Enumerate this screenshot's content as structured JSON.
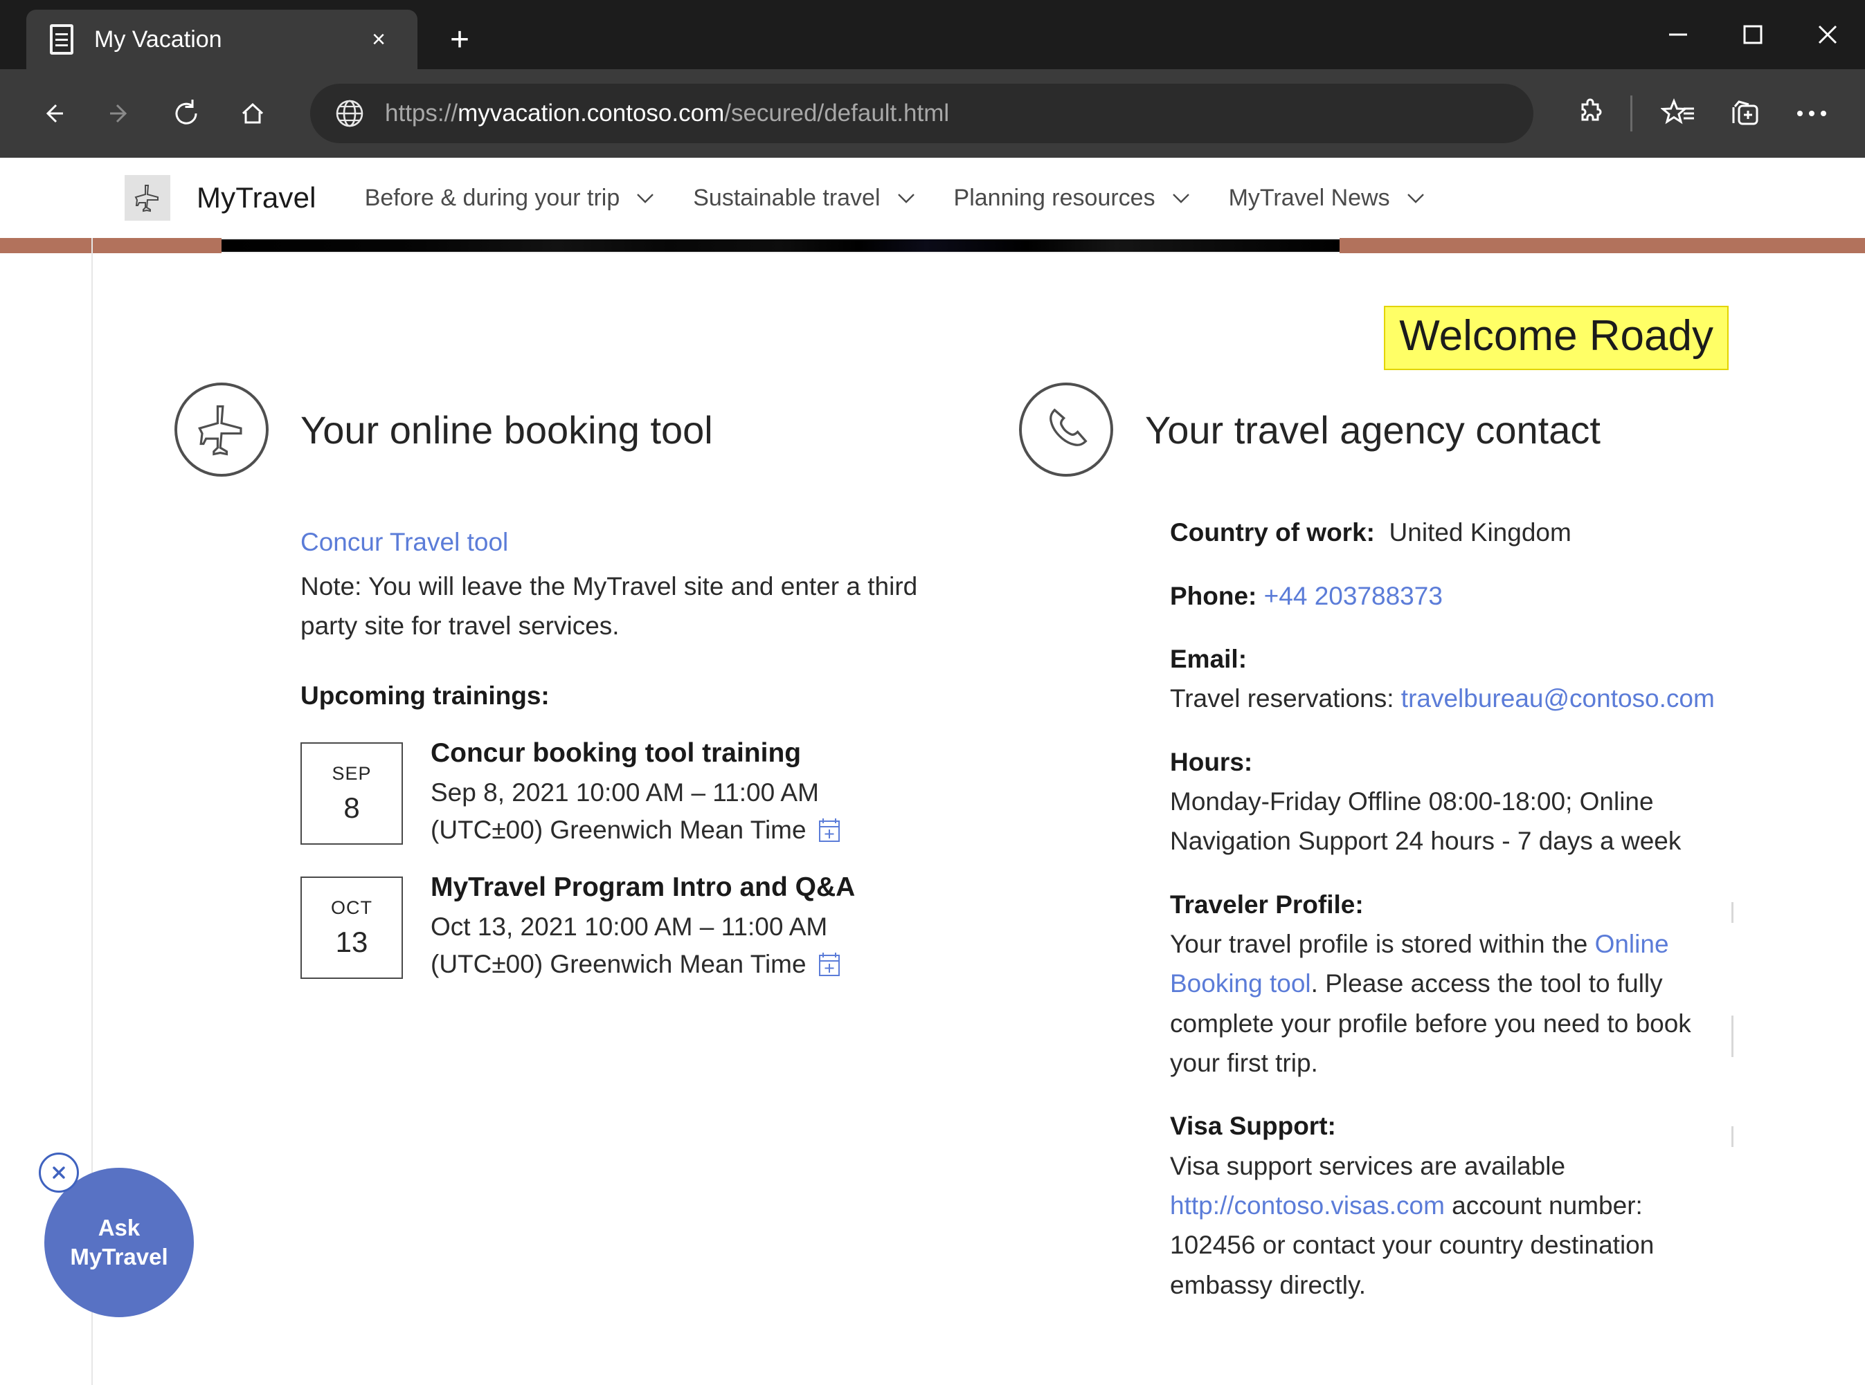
{
  "browser": {
    "tab": {
      "title": "My Vacation",
      "favicon": "document-icon",
      "close_label": "×"
    },
    "new_tab_label": "+",
    "window_controls": {
      "minimize": "minimize-icon",
      "maximize": "maximize-icon",
      "close": "close-icon"
    },
    "nav": {
      "back": "back-arrow-icon",
      "forward": "forward-arrow-icon",
      "refresh": "refresh-icon",
      "home": "home-icon"
    },
    "address": {
      "icon": "globe-icon",
      "scheme": "https://",
      "host": "myvacation.contoso.com",
      "path": "/secured/default.html",
      "full_url": "https://myvacation.contoso.com/secured/default.html"
    },
    "toolbar_icons": [
      "extensions-puzzle-icon",
      "favorites-star-icon",
      "collections-icon",
      "settings-more-icon"
    ]
  },
  "site": {
    "brand": {
      "logo": "airplane-icon",
      "name": "MyTravel"
    },
    "nav_items": [
      {
        "label": "Before & during your trip",
        "chevron": "chevron-down-icon"
      },
      {
        "label": "Sustainable travel",
        "chevron": "chevron-down-icon"
      },
      {
        "label": "Planning resources",
        "chevron": "chevron-down-icon"
      },
      {
        "label": "MyTravel News",
        "chevron": "chevron-down-icon"
      }
    ],
    "hero_accent_color": "#b2725c"
  },
  "welcome": {
    "text": "Welcome Roady",
    "highlight_color": "#ffff66",
    "border_color": "#e3d400"
  },
  "booking": {
    "icon": "airplane-circle-icon",
    "title": "Your online booking tool",
    "tool_link": "Concur Travel tool",
    "note": "Note: You will leave the MyTravel site and enter a third party site for travel services.",
    "trainings_heading": "Upcoming trainings:",
    "events": [
      {
        "month": "SEP",
        "day": "8",
        "title": "Concur booking tool training",
        "when": "Sep 8, 2021   10:00 AM – 11:00 AM",
        "timezone": "(UTC±00) Greenwich Mean Time",
        "calendar_icon": "add-to-calendar-icon"
      },
      {
        "month": "OCT",
        "day": "13",
        "title": "MyTravel Program Intro and Q&A",
        "when": "Oct 13, 2021   10:00 AM – 11:00 AM",
        "timezone": "(UTC±00) Greenwich Mean Time",
        "calendar_icon": "add-to-calendar-icon"
      }
    ]
  },
  "agency": {
    "icon": "phone-circle-icon",
    "title": "Your travel agency contact",
    "country_label": "Country of work:",
    "country_value": "United Kingdom",
    "phone_label": "Phone:",
    "phone_value": "+44 203788373",
    "email_label": "Email:",
    "email_prefix": "Travel reservations:",
    "email_value": "travelbureau@contoso.com",
    "hours_label": "Hours:",
    "hours_value": "Monday-Friday Offline 08:00-18:00; Online Navigation Support 24 hours - 7 days a week",
    "profile_label": "Traveler Profile:",
    "profile_text_1": "Your travel profile is stored within the ",
    "profile_link": "Online Booking tool",
    "profile_text_2": ". Please access the tool to fully complete your profile before you need to book your first trip.",
    "visa_label": "Visa Support:",
    "visa_text_1": "Visa support services are available ",
    "visa_link": "http://contoso.visas.com",
    "visa_text_2": " account number: 102456 or contact your country destination embassy directly."
  },
  "assistant": {
    "line1": "Ask",
    "line2": "MyTravel",
    "close_icon": "close-icon",
    "bubble_color": "#5872c4"
  }
}
